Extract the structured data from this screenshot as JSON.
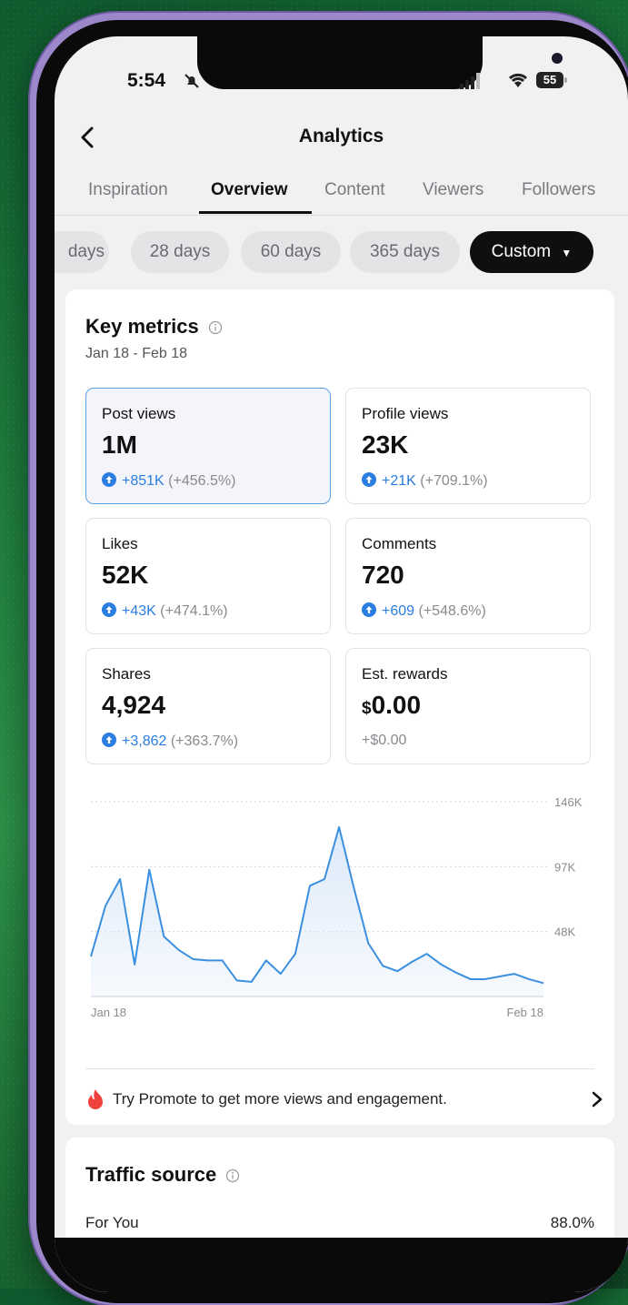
{
  "status_bar": {
    "time": "5:54",
    "battery": "55"
  },
  "header": {
    "title": "Analytics"
  },
  "tabs": [
    {
      "label": "Inspiration",
      "active": false
    },
    {
      "label": "Overview",
      "active": true
    },
    {
      "label": "Content",
      "active": false
    },
    {
      "label": "Viewers",
      "active": false
    },
    {
      "label": "Followers",
      "active": false
    }
  ],
  "range_chips": [
    {
      "label": "days",
      "active": false
    },
    {
      "label": "28 days",
      "active": false
    },
    {
      "label": "60 days",
      "active": false
    },
    {
      "label": "365 days",
      "active": false
    },
    {
      "label": "Custom",
      "active": true
    }
  ],
  "key_metrics": {
    "title": "Key metrics",
    "date_range": "Jan 18 - Feb 18",
    "items": [
      {
        "label": "Post views",
        "value": "1M",
        "delta": "+851K",
        "pct": "(+456.5%)",
        "selected": true
      },
      {
        "label": "Profile views",
        "value": "23K",
        "delta": "+21K",
        "pct": "(+709.1%)"
      },
      {
        "label": "Likes",
        "value": "52K",
        "delta": "+43K",
        "pct": "(+474.1%)"
      },
      {
        "label": "Comments",
        "value": "720",
        "delta": "+609",
        "pct": "(+548.6%)"
      },
      {
        "label": "Shares",
        "value": "4,924",
        "delta": "+3,862",
        "pct": "(+363.7%)"
      },
      {
        "label": "Est. rewards",
        "currency": "$",
        "value": "0.00",
        "delta": "+$0.00",
        "pct": ""
      }
    ]
  },
  "chart_data": {
    "type": "area",
    "series": [
      {
        "values": [
          30000,
          68000,
          88000,
          24000,
          95000,
          45000,
          35000,
          28000,
          27000,
          27000,
          12000,
          11000,
          27000,
          17000,
          32000,
          83000,
          88000,
          127000,
          82000,
          40000,
          23000,
          19000,
          26000,
          32000,
          24000,
          18000,
          13000,
          13000,
          15000,
          17000,
          13000,
          10000
        ]
      }
    ],
    "x_tick_labels": [
      "Jan 18",
      "Feb 18"
    ],
    "y_tick_labels": [
      "146K",
      "97K",
      "48K"
    ],
    "ylim": [
      0,
      146000
    ],
    "grid": true,
    "line_color": "#3b8fe0",
    "fill_color": "#dbe9f9"
  },
  "promo": {
    "text": "Try Promote to get more views and engagement."
  },
  "traffic_source": {
    "title": "Traffic source",
    "first_row": {
      "label": "For You",
      "value": "88.0%"
    }
  },
  "colors": {
    "accent_blue": "#2a7de1",
    "chip_active": "#0f0f10",
    "frame": "#9b87c9"
  }
}
